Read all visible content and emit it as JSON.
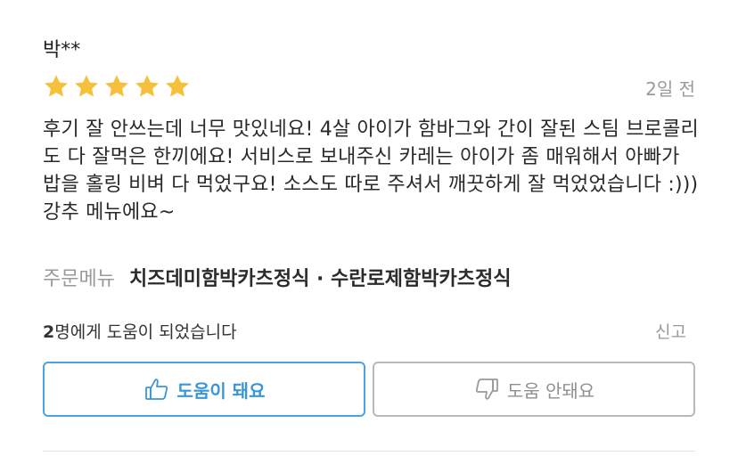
{
  "review": {
    "reviewer_name": "박**",
    "rating": 5,
    "rating_max": 5,
    "date": "2일 전",
    "text": "후기 잘 안쓰는데 너무 맛있네요! 4살 아이가 함바그와 간이 잘된 스팀 브로콜리도 다 잘먹은 한끼에요! 서비스로 보내주신 카레는 아이가 좀 매워해서 아빠가 밥을 홀링 비벼 다 먹었구요! 소스도 따로 주셔서 깨끗하게 잘 먹었었습니다 :))) 강추 메뉴에요~",
    "order_label": "주문메뉴",
    "order_items": "치즈데미함박카츠정식 · 수란로제함박카츠정식",
    "helpful_count": "2",
    "helpful_suffix": "명에게 도움이 되었습니다",
    "report_label": "신고"
  },
  "buttons": {
    "helpful_label": "도움이 돼요",
    "not_helpful_label": "도움 안돼요"
  },
  "colors": {
    "star": "#f5c13d",
    "accent": "#3a96d8",
    "muted": "#9a9a9a"
  },
  "icons": {
    "star": "star-icon",
    "thumbs_up": "thumbs-up-icon",
    "thumbs_down": "thumbs-down-icon"
  }
}
